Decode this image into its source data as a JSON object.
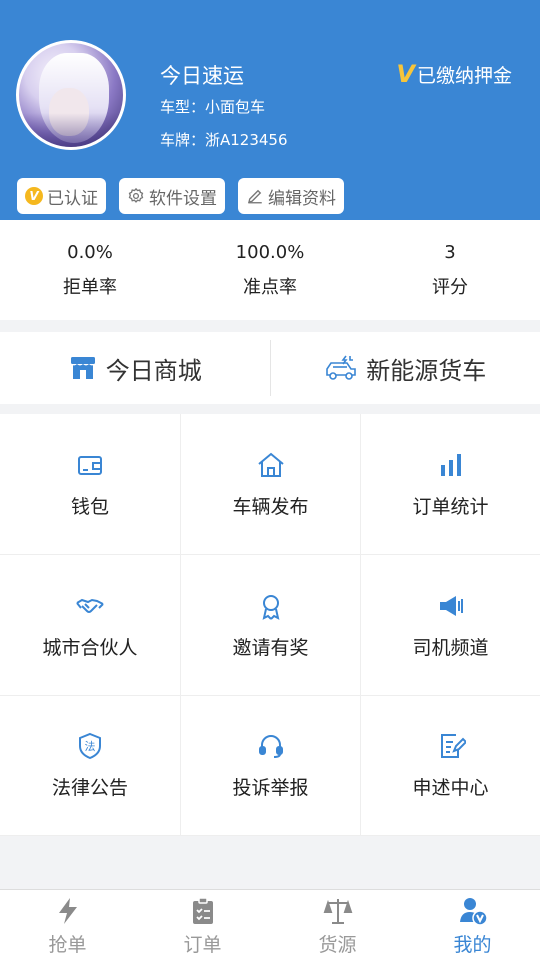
{
  "profile": {
    "name": "今日速运",
    "car_type": "车型：小面包车",
    "plate": "车牌：浙A123456",
    "deposit_mark": "V",
    "deposit": "已缴纳押金"
  },
  "chips": [
    {
      "label": "已认证",
      "icon": "verified-badge-icon",
      "badge": "V"
    },
    {
      "label": "软件设置",
      "icon": "gear-icon"
    },
    {
      "label": "编辑资料",
      "icon": "pencil-icon"
    }
  ],
  "stats": [
    {
      "value": "0.0%",
      "label": "拒单率"
    },
    {
      "value": "100.0%",
      "label": "准点率"
    },
    {
      "value": "3",
      "label": "评分"
    }
  ],
  "promo": [
    {
      "label": "今日商城",
      "icon": "store-icon"
    },
    {
      "label": "新能源货车",
      "icon": "ev-truck-icon"
    }
  ],
  "grid": [
    {
      "label": "钱包",
      "icon": "wallet-icon"
    },
    {
      "label": "车辆发布",
      "icon": "home-icon"
    },
    {
      "label": "订单统计",
      "icon": "bar-chart-icon"
    },
    {
      "label": "城市合伙人",
      "icon": "handshake-icon"
    },
    {
      "label": "邀请有奖",
      "icon": "award-icon"
    },
    {
      "label": "司机频道",
      "icon": "speaker-icon"
    },
    {
      "label": "法律公告",
      "icon": "law-shield-icon"
    },
    {
      "label": "投诉举报",
      "icon": "headset-icon"
    },
    {
      "label": "申述中心",
      "icon": "edit-doc-icon"
    }
  ],
  "tabs": [
    {
      "label": "抢单",
      "icon": "lightning-icon",
      "active": false
    },
    {
      "label": "订单",
      "icon": "clipboard-icon",
      "active": false
    },
    {
      "label": "货源",
      "icon": "scale-icon",
      "active": false
    },
    {
      "label": "我的",
      "icon": "user-verified-icon",
      "active": true
    }
  ],
  "colors": {
    "primary": "#3a86d4",
    "gold": "#f5b81f",
    "inactive": "#999999"
  },
  "grid_icon_law_char": "法"
}
